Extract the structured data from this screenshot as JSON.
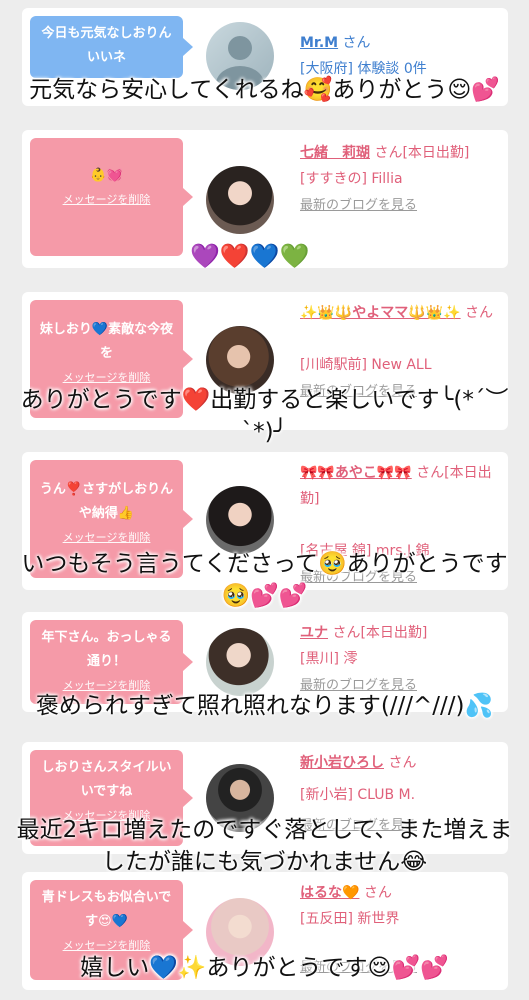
{
  "cards": [
    {
      "bubble": "今日も元気なしおりん　いいネ",
      "delete": "",
      "name": "Mr.M",
      "san": "さん",
      "shop": "[大阪府] 体験談 0件",
      "blog": ""
    },
    {
      "bubble": "👶💓",
      "delete": "メッセージを削除",
      "name": "七緒　莉瑚",
      "san": "さん[本日出勤]",
      "shop": "[すすきの] Fillia",
      "blog": "最新のブログを見る"
    },
    {
      "bubble": "妹しおり💙素敵な今夜を",
      "delete": "メッセージを削除",
      "name": "✨👑🔱やよママ🔱👑✨",
      "san": "さん",
      "shop": "[川崎駅前] New ALL",
      "blog": "最新のブログを見る"
    },
    {
      "bubble": "うん❣️さすがしおりんや納得👍",
      "delete": "メッセージを削除",
      "name": "🎀🎀あやこ🎀🎀",
      "san": "さん[本日出勤]",
      "shop": "[名古屋 錦] mrs.J 錦",
      "blog": "最新のブログを見る"
    },
    {
      "bubble": "年下さん。おっしゃる通り！",
      "delete": "メッセージを削除",
      "name": "ユナ",
      "san": "さん[本日出勤]",
      "shop": "[黒川] 澪",
      "blog": "最新のブログを見る"
    },
    {
      "bubble": "しおりさんスタイルいいですね",
      "delete": "メッセージを削除",
      "name": "新小岩ひろし",
      "san": "さん",
      "shop": "[新小岩] CLUB M.",
      "blog": "最新のブログを見る"
    },
    {
      "bubble": "青ドレスもお似合いです😍💙",
      "delete": "メッセージを削除",
      "name": "はるな🧡",
      "san": "さん",
      "shop": "[五反田] 新世界",
      "blog": "最新のブログを見る"
    }
  ],
  "hearts_row": "💜❤️💙💚",
  "overlays": {
    "o1": "元気なら安心してくれるね🥰ありがとう😌💕",
    "o2": "ありがとうです❤️出勤すると楽しいです╰(*´︶`*)╯",
    "o3": "いつもそう言うてくださって🥹ありがとうです🥹💕💕",
    "o4": "褒められすぎて照れ照れなります(///^///)💦",
    "o5": "最近2キロ増えたのですぐ落として、また増えましたが誰にも気づかれません😂",
    "o6": "嬉しい💙✨ありがとうです😌💕💕"
  },
  "colors": {
    "blue_bubble": "#7fb6f2",
    "pink_bubble": "#f59aa8",
    "pink_text": "#e0607a",
    "blue_text": "#3f7fcf"
  }
}
